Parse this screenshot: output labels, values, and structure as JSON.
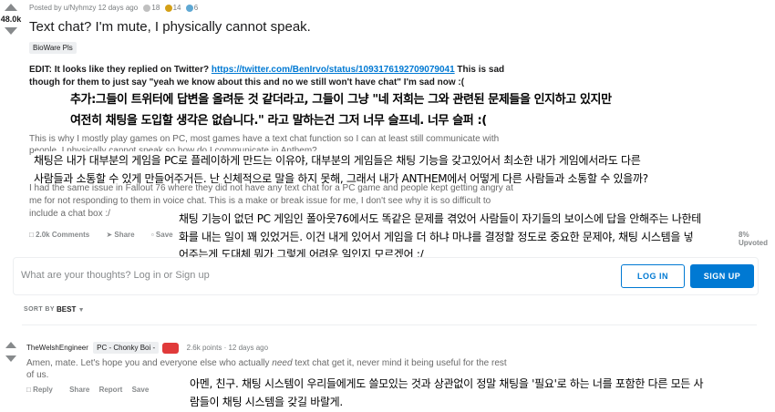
{
  "post": {
    "score": "48.0k",
    "posted_by": "Posted by u/Nyhmzy 12 days ago",
    "awards": [
      {
        "icon": "silver-award-icon",
        "count": "18",
        "color": "#c0c0c0"
      },
      {
        "icon": "gold-award-icon",
        "count": "14",
        "color": "#d4a017"
      },
      {
        "icon": "platinum-award-icon",
        "count": "6",
        "color": "#5fa8d3"
      }
    ],
    "title": "Text chat? I'm mute, I physically cannot speak.",
    "flair": "BioWare Pls",
    "edit_prefix": "EDIT: It looks like they replied on Twitter? ",
    "edit_link": "https://twitter.com/BenIrvo/status/1093176192709079041",
    "edit_suffix_1": " This is sad",
    "edit_line2": "though for them to just say \"yeah we know about this and no we still won't have chat\" I'm sad now :(",
    "ko_1a": "추가:그들이 트위터에 답변을 올려둔 것 같더라고, 그들이 그냥 \"네 저희는 그와 관련된 문제들을 인지하고 있지만",
    "ko_1b": "여전히 채팅을 도입할 생각은 없습니다.\" 라고 말하는건 그저 너무 슬프네. 너무 슬퍼 :(",
    "para1_l1": "This is why I mostly play games on PC, most games have a text chat function so I can at least still communicate with",
    "para1_l2": "people. I physically cannot speak so how do I communicate in Anthem?",
    "ko_2a": "채팅은 내가 대부분의 게임을 PC로 플레이하게 만드는 이유야, 대부분의 게임들은 채팅 기능을 갖고있어서 최소한 내가 게임에서라도 다른",
    "ko_2b": "사람들과 소통할 수 있게 만들어주거든. 난 신체적으로 말을 하지 못해, 그래서 내가 ANTHEM에서 어떻게 다른 사람들과 소통할 수 있을까?",
    "para2_l1": "I had the same issue in Fallout 76 where they did not have any text chat for a PC game and people kept getting angry at",
    "para2_l2": "me for not responding to them in voice chat. This is a make or break issue for me, I don't see why it is so difficult to",
    "para2_l3": "include a chat box :/",
    "ko_3a": "채팅 기능이 없던 PC 게임인 폴아웃76에서도 똑같은 문제를 겪었어 사람들이 자기들의 보이스에 답을 안해주는 나한테",
    "ko_3b": "화를 내는 일이 꽤 있었거든. 이건 내게 있어서 게임을 더 하냐 마냐를 결정할 정도로 중요한 문제야, 채팅 시스템을 넣",
    "ko_3c": "어주는게 도대체 뭐가 그렇게 어려운 일인지 모르겠어 :/",
    "comments_label": "2.0k Comments",
    "share_label": "Share",
    "save_label": "Save",
    "upvoted_label": "8% Upvoted"
  },
  "comment_box": {
    "placeholder": "What are your thoughts? Log in or Sign up",
    "login_label": "LOG IN",
    "signup_label": "SIGN UP"
  },
  "sort": {
    "label": "SORT BY",
    "value": "BEST"
  },
  "comment": {
    "author": "TheWelshEngineer",
    "flair": "PC - Chonky Boi -",
    "points": "2.6k points",
    "age": "12 days ago",
    "text_pre": "Amen, mate. Let's hope you and everyone else who actually ",
    "text_em": "need",
    "text_post": " text chat get it, never mind it being useful for the rest",
    "text_l2": "of us.",
    "reply_label": "Reply",
    "share_label": "Share",
    "report_label": "Report",
    "save_label": "Save",
    "ko_a": "아멘, 친구. 채팅 시스템이 우리들에게도 쓸모있는 것과 상관없이 정말 채팅을 '필요'로 하는 너를 포함한 다른 모든 사",
    "ko_b": "람들이 채팅 시스템을 갖길 바랄게."
  }
}
